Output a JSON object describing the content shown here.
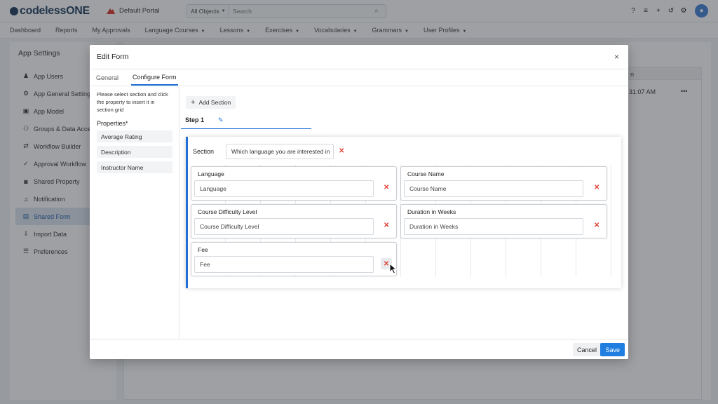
{
  "app": {
    "logo_text": "codelessONE",
    "portal": "Default Portal",
    "search": {
      "scope": "All Objects",
      "placeholder": "Search"
    }
  },
  "nav": [
    "Dashboard",
    "Reports",
    "My Approvals",
    "Language Courses",
    "Lessons",
    "Exercises",
    "Vocabularies",
    "Grammars",
    "User Profiles"
  ],
  "background": {
    "sidebar_title": "App Settings",
    "sidebar_items": [
      "App Users",
      "App General Settings",
      "App Model",
      "Groups & Data Access",
      "Workflow Builder",
      "Approval Workflow",
      "Shared Property",
      "Notification",
      "Shared Form",
      "Import Data",
      "Preferences"
    ],
    "table_header_fragment": "n",
    "time_fragment": "31:07 AM",
    "row_menu": "•••"
  },
  "modal": {
    "title": "Edit Form",
    "close": "×",
    "tabs": [
      "General",
      "Configure Form"
    ],
    "hint": "Please select section and click the property to insert it in section grid",
    "properties_title": "Properties*",
    "properties": [
      "Average Rating",
      "Description",
      "Instructor Name"
    ],
    "add_section": "Add Section",
    "step_label": "Step 1",
    "section": {
      "label": "Section",
      "value": "Which language you are interested in"
    },
    "fields": [
      {
        "label": "Language",
        "value": "Language"
      },
      {
        "label": "Course Name",
        "value": "Course Name"
      },
      {
        "label": "Course Difficulty Level",
        "value": "Course Difficulty Level"
      },
      {
        "label": "Duration in Weeks",
        "value": "Duration in Weeks"
      },
      {
        "label": "Fee",
        "value": "Fee"
      }
    ],
    "cancel": "Cancel",
    "save": "Save"
  },
  "colors": {
    "accent": "#1f7ee0",
    "delete": "#e0443b",
    "active_nav": "#dce6f2"
  }
}
